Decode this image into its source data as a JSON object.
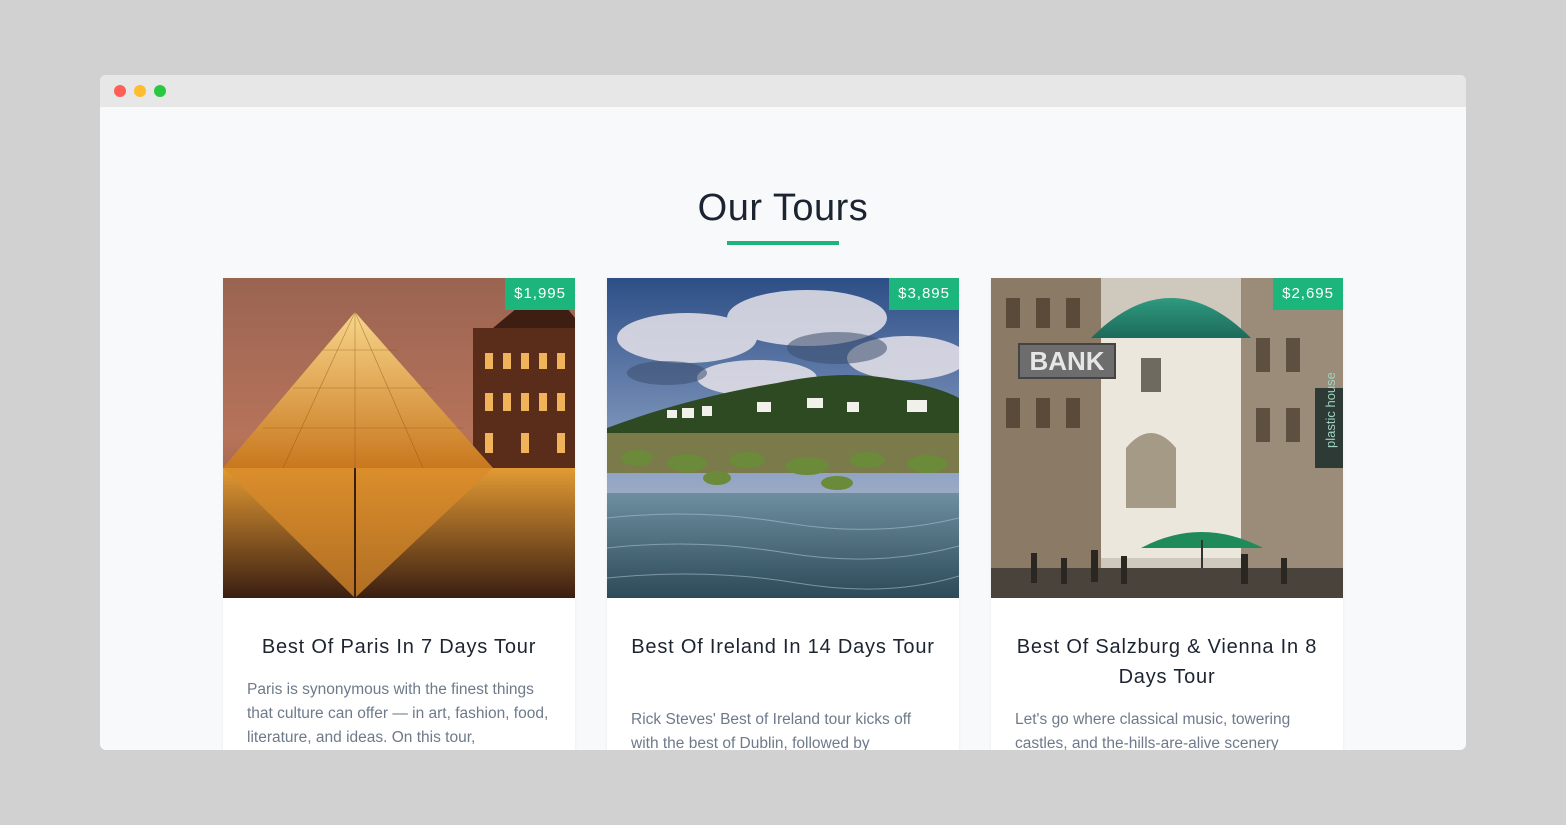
{
  "section": {
    "title": "Our Tours"
  },
  "colors": {
    "accent": "#1cb67c",
    "title_text": "#1c2431",
    "body_text": "#6e7a8a"
  },
  "tours": [
    {
      "price": "$1,995",
      "title": "Best Of Paris In 7 Days Tour",
      "description": "Paris is synonymous with the finest things that culture can offer — in art, fashion, food, literature, and ideas. On this tour,",
      "image": "louvre-pyramid-image"
    },
    {
      "price": "$3,895",
      "title": "Best Of Ireland In 14 Days Tour",
      "description": "Rick Steves' Best of Ireland tour kicks off with the best of Dublin, followed by",
      "image": "irish-coast-image"
    },
    {
      "price": "$2,695",
      "title": "Best Of Salzburg & Vienna In 8 Days Tour",
      "description": "Let's go where classical music, towering castles, and the-hills-are-alive scenery",
      "image": "vienna-street-image",
      "signs": {
        "bank": "BANK",
        "plastic_house": "plastic house"
      }
    }
  ]
}
